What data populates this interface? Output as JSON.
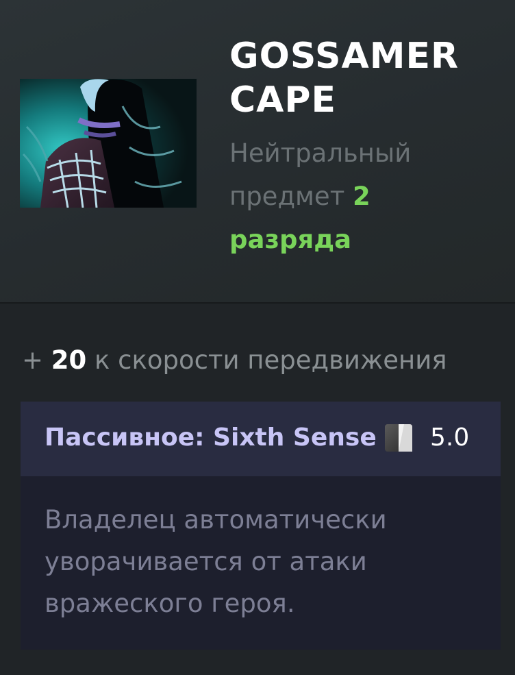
{
  "item": {
    "name_line1": "GOSSAMER",
    "name_line2": "CAPE",
    "subtitle_prefix": "Нейтральный предмет ",
    "tier_number": "2",
    "tier_word": "разряда",
    "image_icon": "gossamer-cape-image"
  },
  "stats": {
    "prefix": "+ ",
    "value": "20",
    "label": " к скорости передвижения"
  },
  "ability": {
    "title": "Пассивное: Sixth Sense",
    "cooldown_icon": "cooldown-icon",
    "cooldown_value": "5.0",
    "description": "Владелец автоматически уворачивается от атаки вражеского героя."
  },
  "colors": {
    "tier_accent": "#79d35a",
    "ability_title": "#c8c5f6",
    "ability_header_bg": "#292c41",
    "ability_body_bg": "#1d1f2d"
  }
}
